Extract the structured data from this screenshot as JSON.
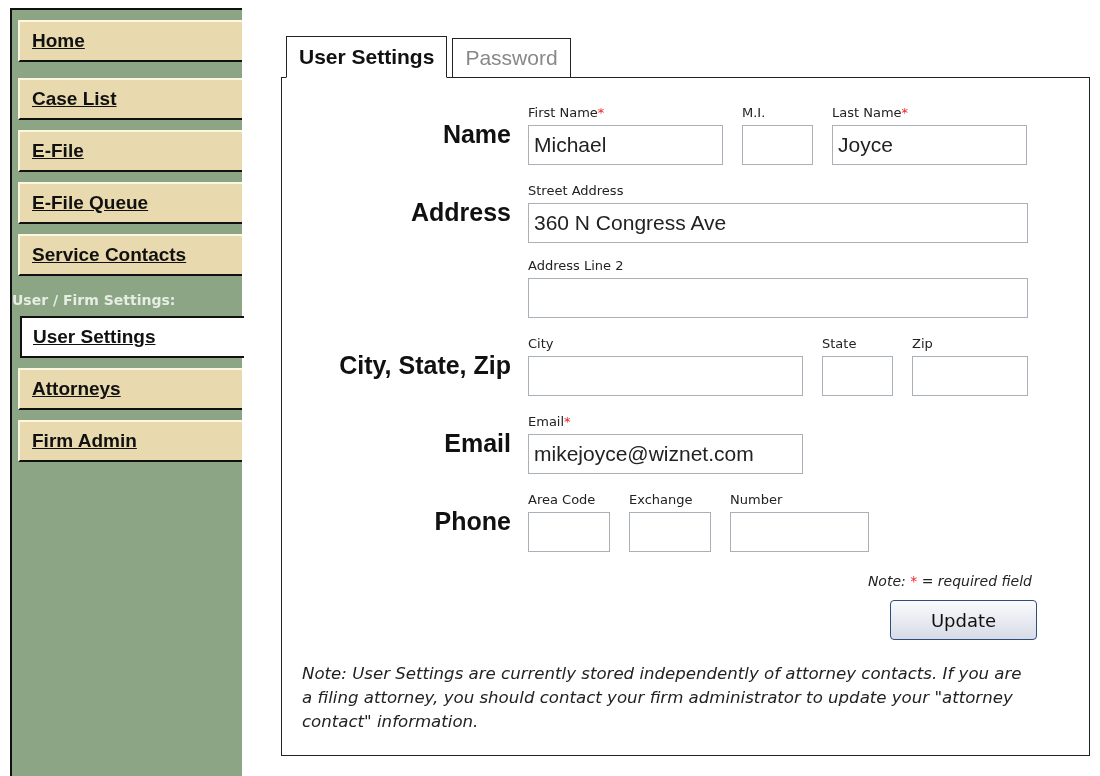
{
  "sidebar": {
    "nav_items": [
      {
        "label": "Home",
        "selected": false
      },
      {
        "label": "Case List",
        "selected": false
      },
      {
        "label": "E-File",
        "selected": false
      },
      {
        "label": "E-File Queue",
        "selected": false
      },
      {
        "label": "Service Contacts",
        "selected": false
      }
    ],
    "section_heading": "User / Firm Settings:",
    "settings_items": [
      {
        "label": "User Settings",
        "selected": true
      },
      {
        "label": "Attorneys",
        "selected": false
      },
      {
        "label": "Firm Admin",
        "selected": false
      }
    ]
  },
  "tabs": [
    {
      "label": "User Settings",
      "selected": true
    },
    {
      "label": "Password",
      "selected": false
    }
  ],
  "form": {
    "required_mark": "*",
    "rows": [
      {
        "label": "Name",
        "lines": [
          [
            {
              "label": "First Name",
              "required": true,
              "value": "Michael",
              "kind": "medium"
            },
            {
              "label": "M.I.",
              "required": false,
              "kind": "tiny"
            },
            {
              "label": "Last Name",
              "required": true,
              "value": "Joyce",
              "kind": "medium"
            }
          ]
        ]
      },
      {
        "label": "Address",
        "lines": [
          [
            {
              "label": "Street Address",
              "required": false,
              "value": "360 N Congress Ave",
              "kind": "wide"
            }
          ],
          [
            {
              "label": "Address Line 2",
              "required": false,
              "kind": "wide"
            }
          ]
        ]
      },
      {
        "label": "City, State, Zip",
        "lines": [
          [
            {
              "label": "City",
              "required": false,
              "kind": "long"
            },
            {
              "label": "State",
              "required": false,
              "kind": "tiny"
            },
            {
              "label": "Zip",
              "required": false,
              "kind": "short"
            }
          ]
        ]
      },
      {
        "label": "Email",
        "lines": [
          [
            {
              "label": "Email",
              "required": true,
              "value": "mikejoyce@wiznet.com",
              "kind": "long"
            }
          ]
        ]
      },
      {
        "label": "Phone",
        "lines": [
          [
            {
              "label": "Area Code",
              "required": false,
              "kind": "small"
            },
            {
              "label": "Exchange",
              "required": false,
              "kind": "small"
            },
            {
              "label": "Number",
              "required": false,
              "kind": "number"
            }
          ]
        ]
      }
    ],
    "required_note": {
      "prefix": "Note:",
      "text": "= required field"
    },
    "submit_button": "Update",
    "footnote": "Note: User Settings are currently stored independently of attorney contacts. If you are a filing attorney, you should contact your firm administrator to update your \"attorney contact\" information."
  }
}
